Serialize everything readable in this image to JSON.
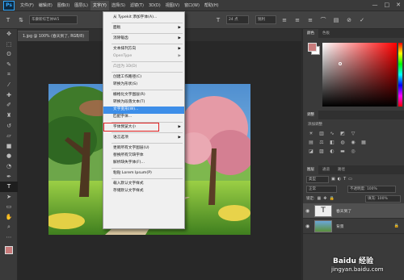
{
  "menubar": {
    "logo": "Ps",
    "items": [
      "文件(F)",
      "编辑(E)",
      "图像(I)",
      "图层(L)",
      "文字(Y)",
      "选择(S)",
      "滤镜(T)",
      "3D(D)",
      "视图(V)",
      "窗口(W)",
      "帮助(H)"
    ],
    "window_controls": [
      "—",
      "□",
      "✕"
    ]
  },
  "options": {
    "font_family": "华康新综艺体W5",
    "font_style": "—",
    "font_size": "24 点",
    "antialias": "锐利"
  },
  "document_tab": "1.jpg @ 100% (春天到了, RGB/8)",
  "dropdown": {
    "items": [
      {
        "label": "从 Typekit 添加字体(A)...",
        "disabled": false,
        "submenu": false
      },
      {
        "label": "面板",
        "disabled": false,
        "submenu": true
      },
      {
        "label": "消除锯齿",
        "disabled": false,
        "submenu": true
      },
      {
        "label": "文本排列方向",
        "disabled": false,
        "submenu": true
      },
      {
        "label": "OpenType",
        "disabled": true,
        "submenu": true
      },
      {
        "label": "凸出为 3D(D)",
        "disabled": true,
        "submenu": false
      },
      {
        "label": "创建工作路径(C)",
        "disabled": false,
        "submenu": false
      },
      {
        "label": "转换为形状(S)",
        "disabled": false,
        "submenu": false
      },
      {
        "label": "栅格化文字图层(R)",
        "disabled": false,
        "submenu": false
      },
      {
        "label": "转换为段落文本(T)",
        "disabled": false,
        "submenu": false
      },
      {
        "label": "文字变形(W)...",
        "disabled": false,
        "submenu": false,
        "highlighted": true
      },
      {
        "label": "匹配字体...",
        "disabled": false,
        "submenu": false
      },
      {
        "label": "字体预览大小",
        "disabled": false,
        "submenu": true
      },
      {
        "label": "语言选项",
        "disabled": false,
        "submenu": true
      },
      {
        "label": "更新所有文字图层(U)",
        "disabled": false,
        "submenu": false
      },
      {
        "label": "替换所有欠缺字体",
        "disabled": false,
        "submenu": false
      },
      {
        "label": "解析缺失字体(F)...",
        "disabled": false,
        "submenu": false
      },
      {
        "label": "粘贴 Lorem Ipsum(P)",
        "disabled": false,
        "submenu": false
      },
      {
        "label": "载入默认文字样式",
        "disabled": false,
        "submenu": false
      },
      {
        "label": "存储默认文字样式",
        "disabled": false,
        "submenu": false
      }
    ]
  },
  "panels": {
    "color_tabs": [
      "颜色",
      "色板"
    ],
    "adjust_tab": "调整",
    "adjust_title": "添加调整",
    "layer_tabs": [
      "图层",
      "通道",
      "路径"
    ],
    "blend_mode": "正常",
    "opacity_label": "不透明度: 100%",
    "lock_label": "锁定:",
    "fill_label": "填充: 100%",
    "kind_label": "类型",
    "layers": [
      {
        "name": "春天到了",
        "type": "text",
        "selected": true
      },
      {
        "name": "背景",
        "type": "image",
        "selected": false
      }
    ]
  },
  "watermark": {
    "logo": "Baidu 经验",
    "url": "jingyan.baidu.com"
  },
  "colors": {
    "foreground": "#c87b7b",
    "highlight": "#3d8ee8",
    "callout": "#e02020"
  }
}
